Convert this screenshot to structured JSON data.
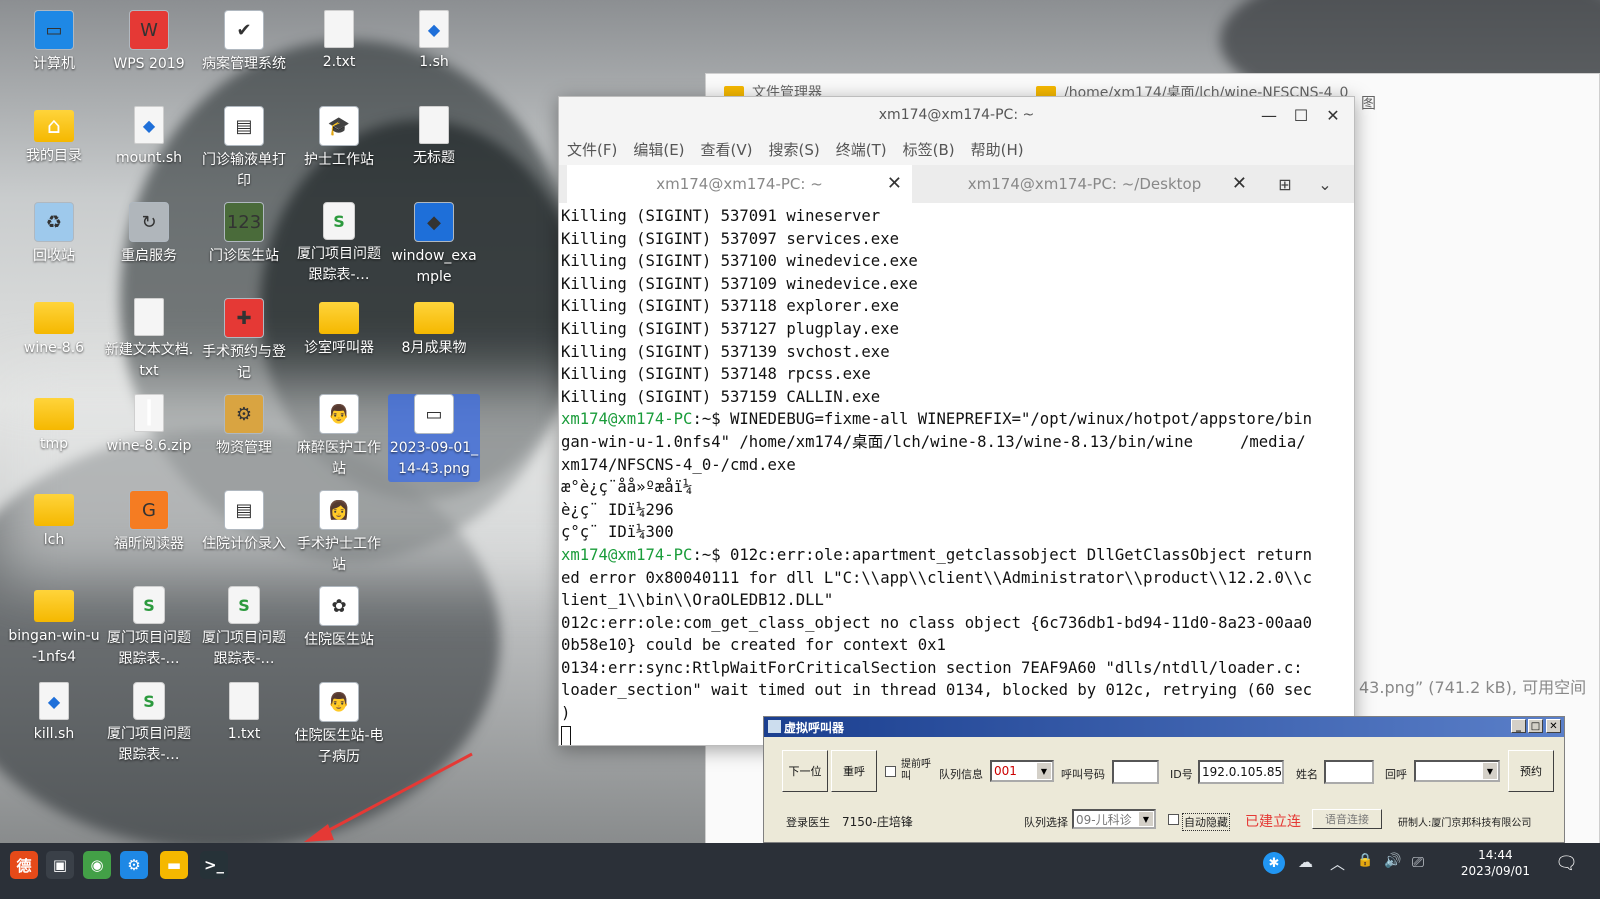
{
  "desktop": {
    "icons": [
      {
        "label": "计算机",
        "glyph": "▭",
        "kind": "app",
        "bg": "#1e88e5"
      },
      {
        "label": "我的目录",
        "glyph": "⌂",
        "kind": "folder"
      },
      {
        "label": "回收站",
        "glyph": "♻",
        "kind": "app",
        "bg": "#9ec9ec"
      },
      {
        "label": "wine-8.6",
        "glyph": "",
        "kind": "folder"
      },
      {
        "label": "tmp",
        "glyph": "",
        "kind": "folder"
      },
      {
        "label": "lch",
        "glyph": "",
        "kind": "folder"
      },
      {
        "label": "bingan-win-u-1nfs4",
        "glyph": "",
        "kind": "folder"
      },
      {
        "label": "kill.sh",
        "glyph": "◆",
        "kind": "sh"
      },
      {
        "label": "WPS 2019",
        "glyph": "W",
        "kind": "app",
        "bg": "#e53935"
      },
      {
        "label": "mount.sh",
        "glyph": "◆",
        "kind": "sh"
      },
      {
        "label": "重启服务",
        "glyph": "↻",
        "kind": "app",
        "bg": "#b0b6bb"
      },
      {
        "label": "新建文本文档.txt",
        "glyph": "",
        "kind": "doc"
      },
      {
        "label": "wine-8.6.zip",
        "glyph": "┃",
        "kind": "doc"
      },
      {
        "label": "福昕阅读器",
        "glyph": "G",
        "kind": "app",
        "bg": "#f57c22"
      },
      {
        "label": "厦门项目问题跟踪表-…",
        "glyph": "S",
        "kind": "sheet"
      },
      {
        "label": "厦门项目问题跟踪表-…",
        "glyph": "S",
        "kind": "sheet"
      },
      {
        "label": "病案管理系统",
        "glyph": "✔",
        "kind": "app",
        "bg": "#ffffff"
      },
      {
        "label": "门诊输液单打印",
        "glyph": "▤",
        "kind": "app",
        "bg": "#ffffff"
      },
      {
        "label": "门诊医生站",
        "glyph": "123",
        "kind": "app",
        "bg": "#4a6b3a"
      },
      {
        "label": "手术预约与登记",
        "glyph": "✚",
        "kind": "app",
        "bg": "#e53935"
      },
      {
        "label": "物资管理",
        "glyph": "⚙",
        "kind": "app",
        "bg": "#d9a441"
      },
      {
        "label": "住院计价录入",
        "glyph": "▤",
        "kind": "app",
        "bg": "#ffffff"
      },
      {
        "label": "厦门项目问题跟踪表-…",
        "glyph": "S",
        "kind": "sheet"
      },
      {
        "label": "1.txt",
        "glyph": "",
        "kind": "doc"
      },
      {
        "label": "2.txt",
        "glyph": "",
        "kind": "doc"
      },
      {
        "label": "护士工作站",
        "glyph": "🎓",
        "kind": "app",
        "bg": "#ffffff"
      },
      {
        "label": "厦门项目问题跟踪表-…",
        "glyph": "S",
        "kind": "sheet"
      },
      {
        "label": "诊室呼叫器",
        "glyph": "",
        "kind": "folder"
      },
      {
        "label": "麻醉医护工作站",
        "glyph": "👨",
        "kind": "app",
        "bg": "#ffffff"
      },
      {
        "label": "手术护士工作站",
        "glyph": "👩",
        "kind": "app",
        "bg": "#ffffff"
      },
      {
        "label": "住院医生站",
        "glyph": "✿",
        "kind": "app",
        "bg": "#ffffff"
      },
      {
        "label": "住院医生站-电子病历",
        "glyph": "👨",
        "kind": "app",
        "bg": "#ffffff"
      },
      {
        "label": "1.sh",
        "glyph": "◆",
        "kind": "sh"
      },
      {
        "label": "无标题",
        "glyph": "",
        "kind": "doc"
      },
      {
        "label": "window_example",
        "glyph": "◆",
        "kind": "app",
        "bg": "#1e6fd9"
      },
      {
        "label": "8月成果物",
        "glyph": "",
        "kind": "folder"
      },
      {
        "label": "2023-09-01_14-43.png",
        "glyph": "▭",
        "kind": "app",
        "bg": "#ffffff"
      }
    ]
  },
  "filemanager": {
    "tab1": "文件管理器",
    "tab2": "/home/xm174/桌面/lch/wine-NFSCNS-4_0",
    "tab3": "图",
    "status": "43.png” (741.2 kB), 可用空间"
  },
  "terminal": {
    "title": "xm174@xm174-PC: ~",
    "menu": [
      "文件(F)",
      "编辑(E)",
      "查看(V)",
      "搜索(S)",
      "终端(T)",
      "标签(B)",
      "帮助(H)"
    ],
    "tabs": [
      "xm174@xm174-PC: ~",
      "xm174@xm174-PC: ~/Desktop"
    ],
    "lines": [
      {
        "p": "",
        "t": "Killing (SIGINT) 537091 wineserver"
      },
      {
        "p": "",
        "t": "Killing (SIGINT) 537097 services.exe"
      },
      {
        "p": "",
        "t": "Killing (SIGINT) 537100 winedevice.exe"
      },
      {
        "p": "",
        "t": "Killing (SIGINT) 537109 winedevice.exe"
      },
      {
        "p": "",
        "t": "Killing (SIGINT) 537118 explorer.exe"
      },
      {
        "p": "",
        "t": "Killing (SIGINT) 537127 plugplay.exe"
      },
      {
        "p": "",
        "t": "Killing (SIGINT) 537139 svchost.exe"
      },
      {
        "p": "",
        "t": "Killing (SIGINT) 537148 rpcss.exe"
      },
      {
        "p": "",
        "t": "Killing (SIGINT) 537159 CALLIN.exe"
      },
      {
        "p": "xm174@xm174-PC",
        "t": ":~$ WINEDEBUG=fixme-all WINEPREFIX=\"/opt/winux/hotpot/appstore/bin"
      },
      {
        "p": "",
        "t": "gan-win-u-1.0nfs4\" /home/xm174/桌面/lch/wine-8.13/wine-8.13/bin/wine     /media/"
      },
      {
        "p": "",
        "t": "xm174/NFSCNS-4_0-/cmd.exe"
      },
      {
        "p": "",
        "t": "æ°è¿ç¨åå»ºæåï¼"
      },
      {
        "p": "",
        "t": "è¿ç¨ IDï¼296"
      },
      {
        "p": "",
        "t": "ç°ç¨ IDï¼300"
      },
      {
        "p": "xm174@xm174-PC",
        "t": ":~$ 012c:err:ole:apartment_getclassobject DllGetClassObject return"
      },
      {
        "p": "",
        "t": "ed error 0x80040111 for dll L\"C:\\\\app\\\\client\\\\Administrator\\\\product\\\\12.2.0\\\\c"
      },
      {
        "p": "",
        "t": "lient_1\\\\bin\\\\OraOLEDB12.DLL\""
      },
      {
        "p": "",
        "t": "012c:err:ole:com_get_class_object no class object {6c736db1-bd94-11d0-8a23-00aa0"
      },
      {
        "p": "",
        "t": "0b58e10} could be created for context 0x1"
      },
      {
        "p": "",
        "t": "0134:err:sync:RtlpWaitForCriticalSection section 7EAF9A60 \"dlls/ntdll/loader.c:"
      },
      {
        "p": "",
        "t": "loader_section\" wait timed out in thread 0134, blocked by 012c, retrying (60 sec"
      },
      {
        "p": "",
        "t": ")"
      }
    ]
  },
  "caller": {
    "title": "虚拟呼叫器",
    "btn_next": "下一位",
    "btn_recall": "重呼",
    "chk_pre": "提前呼叫",
    "lbl_queue": "队列信息",
    "queue_value": "001",
    "lbl_callno": "呼叫号码",
    "callno_value": "",
    "lbl_id": "ID号",
    "id_value": "192.0.105.85",
    "lbl_name": "姓名",
    "name_value": "",
    "lbl_return": "回呼",
    "return_value": "",
    "btn_reserve": "预约",
    "lbl_doctor": "登录医生",
    "doctor_value": "7150-庄培锋",
    "lbl_queue_select": "队列选择",
    "queue_select_value": "09-儿科诊",
    "chk_auto": "自动隐藏",
    "status": "已建立连",
    "btn_voice": "语音连接",
    "developer": "研制人:厦门京邦科技有限公司"
  },
  "taskbar": {
    "apps": [
      {
        "name": "deepin-app",
        "glyph": "德",
        "bg": "#e64a19"
      },
      {
        "name": "multitask",
        "glyph": "▣",
        "bg": "#3a4048"
      },
      {
        "name": "browser",
        "glyph": "◉",
        "bg": "#43a047"
      },
      {
        "name": "settings",
        "glyph": "⚙",
        "bg": "#1e88e5"
      },
      {
        "name": "files",
        "glyph": "▬",
        "bg": "#f5b800"
      },
      {
        "name": "terminal",
        "glyph": ">_",
        "bg": "#263238"
      }
    ],
    "tray": [
      "✱",
      "☁",
      "︿",
      "🔒",
      "🔊",
      "⎚"
    ],
    "time": "14:44",
    "date": "2023/09/01"
  }
}
